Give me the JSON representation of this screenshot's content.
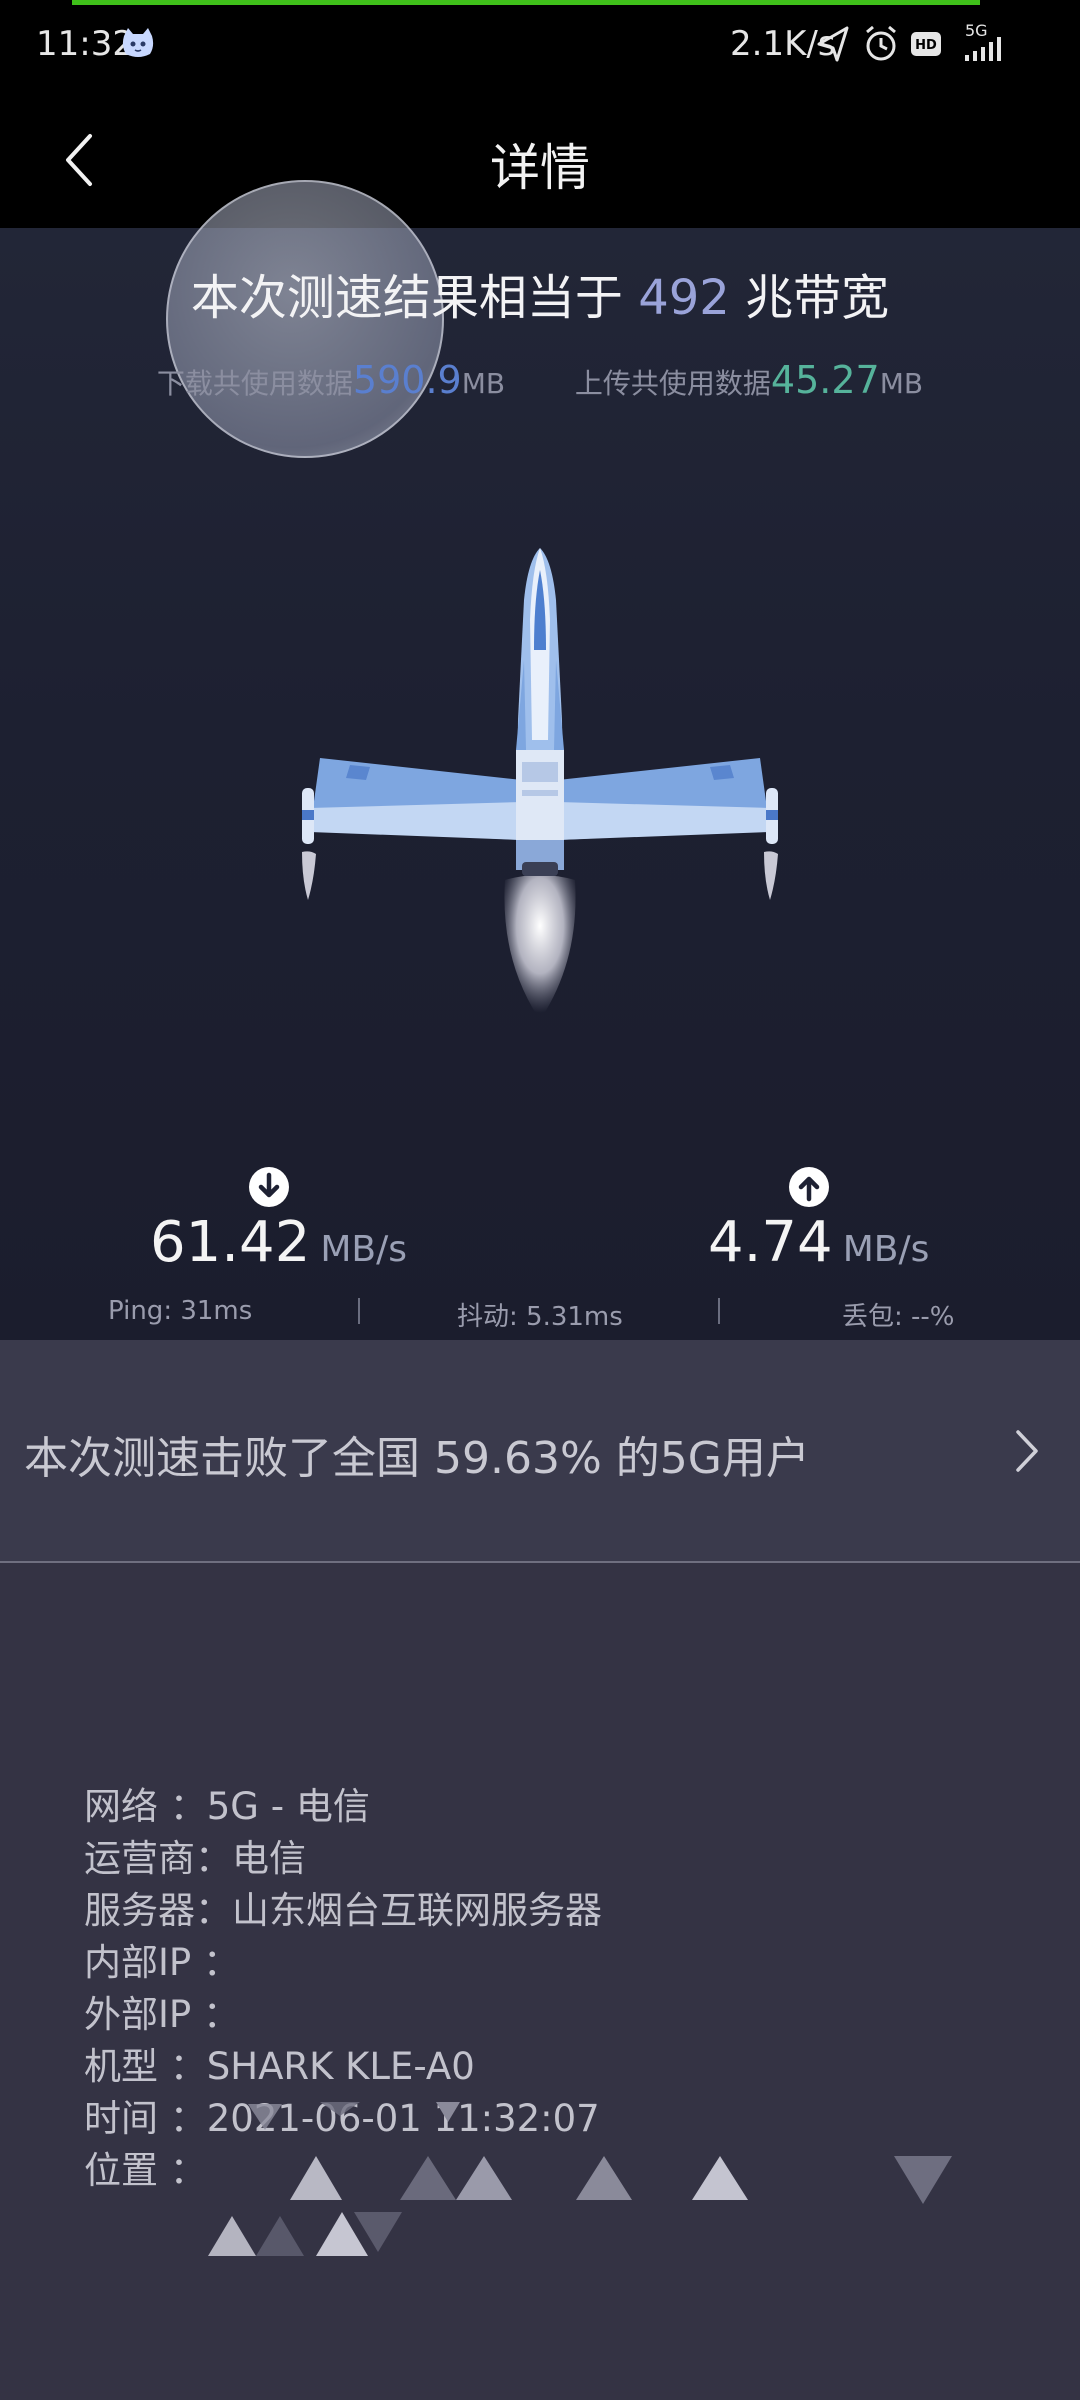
{
  "status_bar": {
    "time": "11:32",
    "net_speed": "2.1K/s",
    "network_type": "5G",
    "icons": [
      "cat-app-icon",
      "location-arrow-icon",
      "alarm-icon",
      "hd-icon",
      "signal-icon"
    ]
  },
  "header": {
    "title": "详情",
    "back_icon": "chevron-left-icon"
  },
  "result": {
    "headline_prefix": "本次测速结果相当于",
    "bandwidth": "492",
    "headline_suffix": "兆带宽",
    "download_used_label": "下载共使用数据",
    "download_used_value": "590.9",
    "download_used_unit": "MB",
    "upload_used_label": "上传共使用数据",
    "upload_used_value": "45.27",
    "upload_used_unit": "MB"
  },
  "speeds": {
    "download_value": "61.42",
    "download_unit": "MB/s",
    "upload_value": "4.74",
    "upload_unit": "MB/s",
    "ping": "Ping:  31ms",
    "jitter": "抖动:  5.31ms",
    "loss": "丢包:  --%"
  },
  "beat": {
    "text": "本次测速击败了全国 59.63% 的5G用户"
  },
  "info": {
    "network": "网络 ：5G - 电信",
    "carrier": "运营商：电信",
    "server": "服务器：山东烟台互联网服务器",
    "internal_ip": "内部IP ：",
    "external_ip": "外部IP ：",
    "model": "机型 ：SHARK KLE-A0",
    "time": "时间 ：2021-06-01 11:32:07",
    "location": "位置 ："
  },
  "colors": {
    "accent_bandwidth": "#9aa3d9",
    "download_accent": "#5a7fcf",
    "upload_accent": "#56b39b",
    "progress_green": "#3fc01a"
  }
}
